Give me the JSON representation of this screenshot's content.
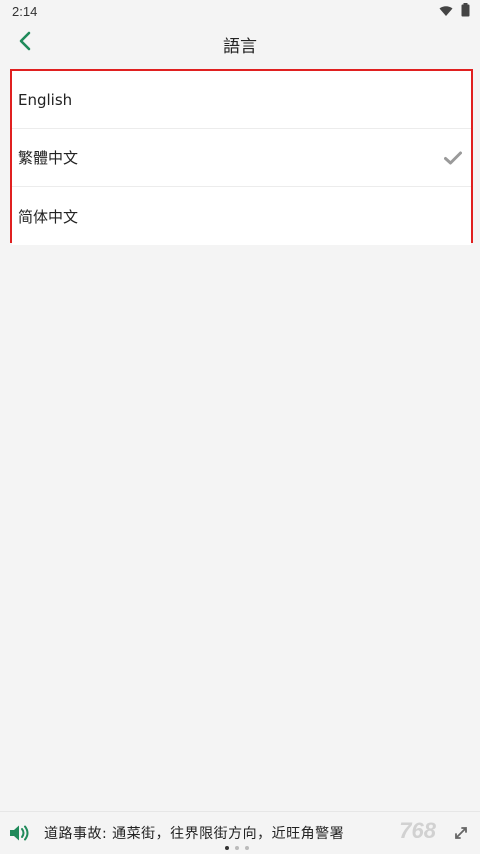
{
  "status_bar": {
    "time": "2:14",
    "icons": [
      "wifi-icon",
      "battery-icon"
    ]
  },
  "header": {
    "title": "語言",
    "back_icon": "chevron-left-icon",
    "accent_color": "#1f8a5a"
  },
  "languages": {
    "items": [
      {
        "label": "English",
        "selected": false
      },
      {
        "label": "繁體中文",
        "selected": true
      },
      {
        "label": "简体中文",
        "selected": false
      }
    ],
    "highlight_color": "#e02020",
    "check_color": "#9a9a9a"
  },
  "ticker": {
    "icon": "speaker-icon",
    "text": "道路事故: 通菜街，往界限街方向，近旺角警署",
    "watermark": "768",
    "collapse_icon": "collapse-icon",
    "page_count": 3,
    "active_page": 1
  }
}
